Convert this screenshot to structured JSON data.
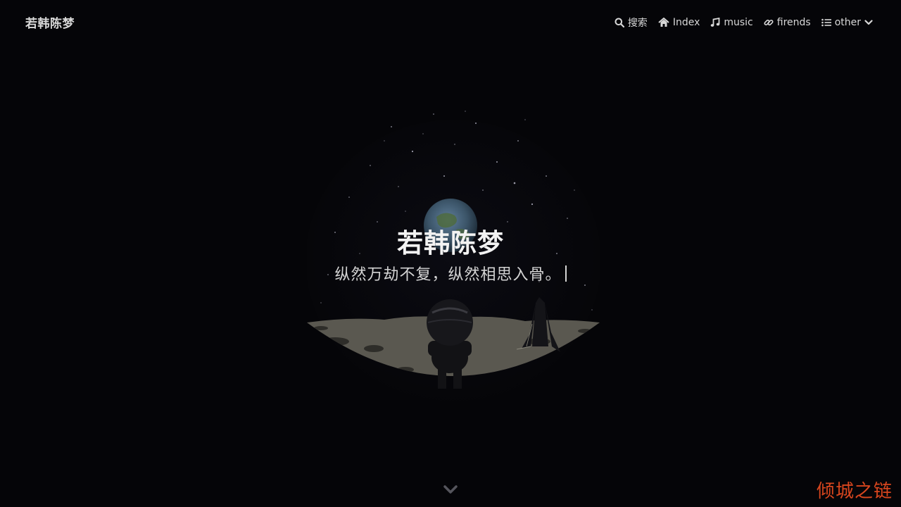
{
  "header": {
    "brand": "若韩陈梦",
    "menu": [
      {
        "label": "搜索",
        "icon": "search-icon"
      },
      {
        "label": "Index",
        "icon": "home-icon"
      },
      {
        "label": "music",
        "icon": "music-icon"
      },
      {
        "label": "firends",
        "icon": "link-icon"
      },
      {
        "label": "other",
        "icon": "list-icon",
        "dropdown": "chevron-down-icon"
      }
    ]
  },
  "hero": {
    "title": "若韩陈梦",
    "subtitle": "纵然万劫不复，纵然相思入骨。"
  },
  "scroll_icon": "chevron-down-icon",
  "watermark": "倾城之链",
  "colors": {
    "background": "#050508",
    "nav_text": "#d8d8d8",
    "title": "#f2f2f2",
    "watermark": "#d8461e",
    "moon_surface": "#5a5850"
  }
}
